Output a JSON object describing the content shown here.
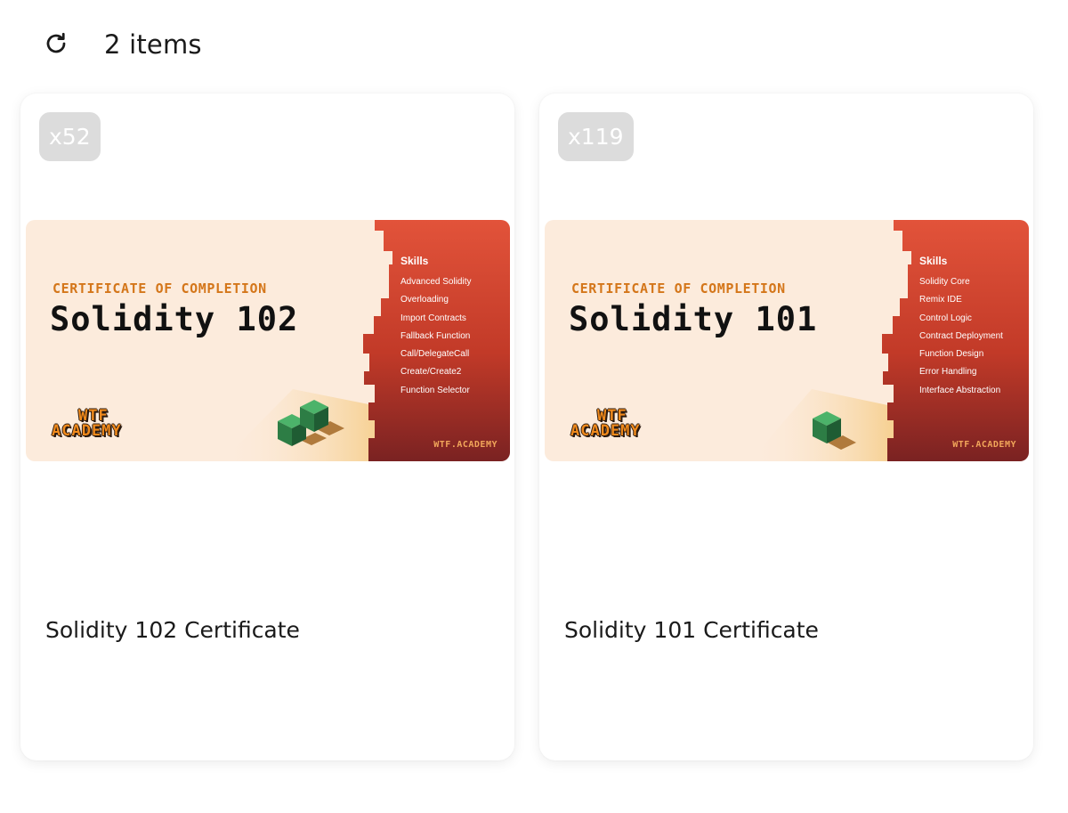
{
  "header": {
    "refresh_icon": "refresh-icon",
    "item_count": "2 items"
  },
  "cards": [
    {
      "quantity": "x52",
      "name": "Solidity 102 Certificate",
      "certificate": {
        "eyebrow": "CERTIFICATE OF COMPLETION",
        "title": "Solidity 102",
        "skills_heading": "Skills",
        "skills": [
          "Advanced Solidity",
          "Overloading",
          "Import Contracts",
          "Fallback Function",
          "Call/DelegateCall",
          "Create/Create2",
          "Function Selector"
        ],
        "logo_line1": "WTF",
        "logo_line2": "ACADEMY",
        "site": "WTF.ACADEMY"
      }
    },
    {
      "quantity": "x119",
      "name": "Solidity 101 Certificate",
      "certificate": {
        "eyebrow": "CERTIFICATE OF COMPLETION",
        "title": "Solidity 101",
        "skills_heading": "Skills",
        "skills": [
          "Solidity Core",
          "Remix IDE",
          "Control Logic",
          "Contract Deployment",
          "Function Design",
          "Error Handling",
          "Interface Abstraction"
        ],
        "logo_line1": "WTF",
        "logo_line2": "ACADEMY",
        "site": "WTF.ACADEMY"
      }
    }
  ],
  "colors": {
    "cert_background": "#fcebdc",
    "cert_panel_top": "#e2533a",
    "cert_panel_bottom": "#7a2222",
    "eyebrow": "#d4761a",
    "badge_background": "#dcdcdc"
  }
}
